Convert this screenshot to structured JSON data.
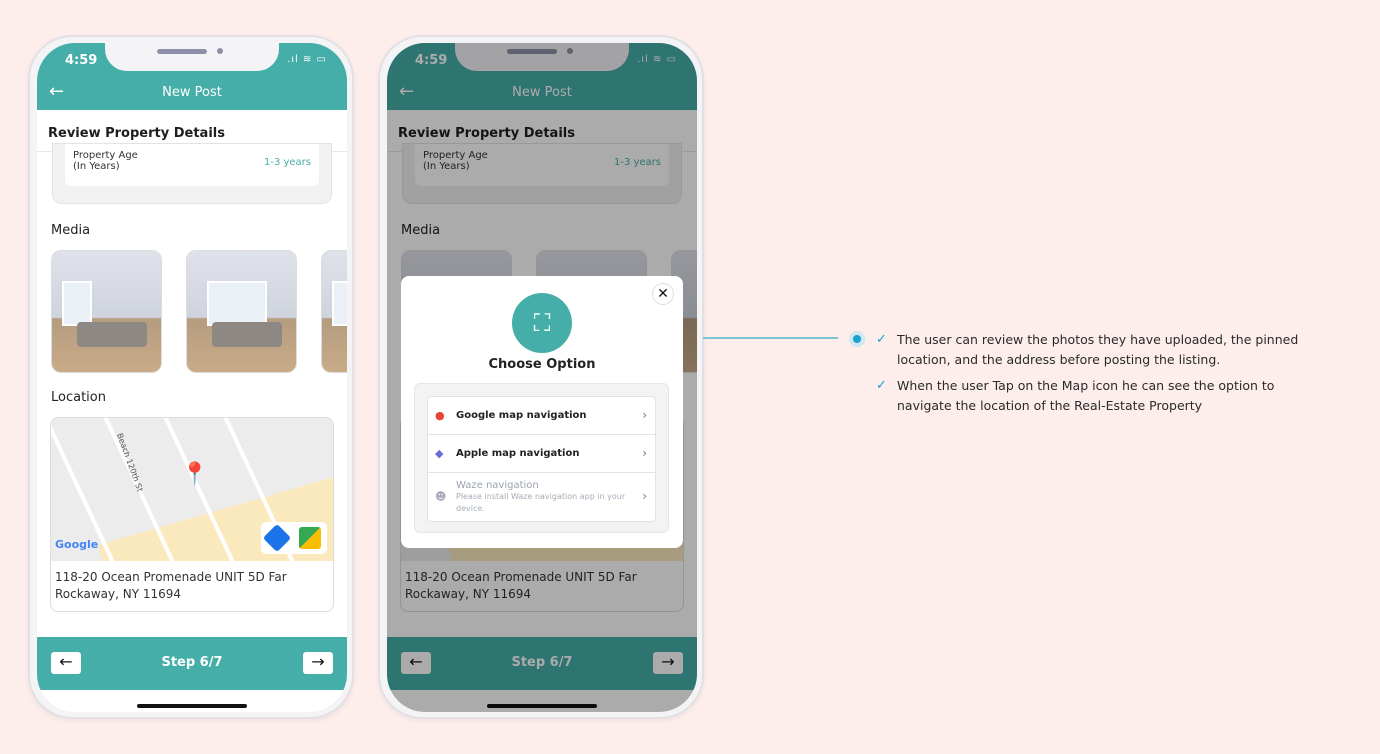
{
  "status": {
    "time": "4:59"
  },
  "header": {
    "title": "New Post",
    "back_icon": "arrow-left-icon"
  },
  "section_title": "Review Property Details",
  "property_age": {
    "label_line1": "Property Age",
    "label_line2": "(In Years)",
    "value": "1-3 years"
  },
  "media": {
    "title": "Media"
  },
  "location": {
    "title": "Location",
    "street": "Beach 120th St",
    "map_brand": "Google",
    "address": "118-20 Ocean Promenade UNIT 5D Far Rockaway, NY 11694"
  },
  "footer": {
    "step": "Step 6/7"
  },
  "modal": {
    "title": "Choose Option",
    "options": [
      {
        "label": "Google map navigation"
      },
      {
        "label": "Apple map navigation"
      },
      {
        "label": "Waze navigation",
        "note": "Please install Waze navigation app in your device."
      }
    ]
  },
  "notes": [
    "The user can review the photos they have uploaded, the pinned location, and the address before posting the listing.",
    "When the user Tap on the Map icon he can see the option to navigate the location of the Real-Estate Property"
  ],
  "colors": {
    "primary": "#45aea8",
    "accent": "#1aa0cf",
    "background": "#fdeeec"
  }
}
